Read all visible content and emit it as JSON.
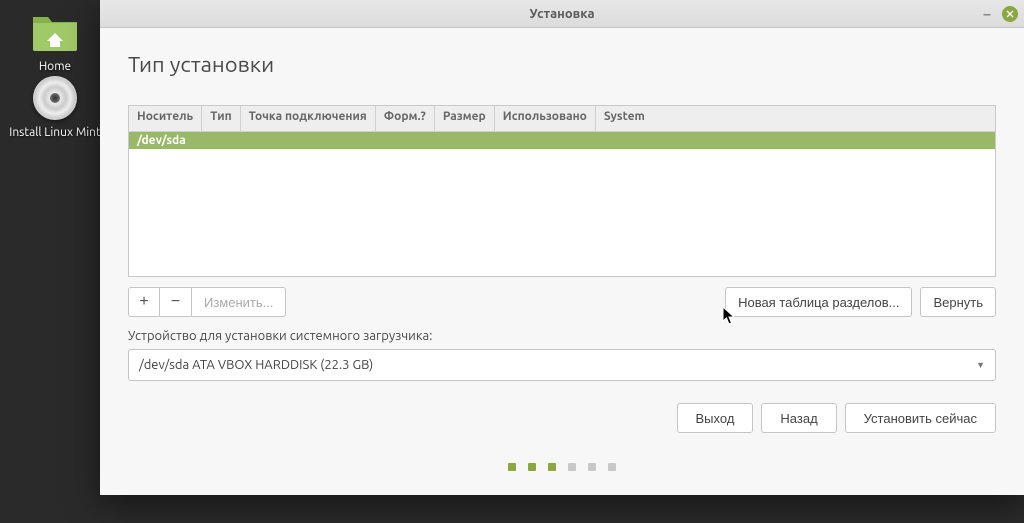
{
  "desktop": {
    "home_label": "Home",
    "installer_label": "Install Linux Mint"
  },
  "window": {
    "title": "Установка"
  },
  "page": {
    "title": "Тип установки"
  },
  "table": {
    "columns": [
      "Носитель",
      "Тип",
      "Точка подключения",
      "Форм.?",
      "Размер",
      "Использовано",
      "System"
    ],
    "rows": [
      {
        "device": "/dev/sda"
      }
    ]
  },
  "toolbar": {
    "add": "+",
    "remove": "−",
    "change": "Изменить...",
    "new_table": "Новая таблица разделов...",
    "revert": "Вернуть"
  },
  "bootloader": {
    "label": "Устройство для установки системного загрузчика:",
    "value": "/dev/sda  ATA VBOX HARDDISK (22.3 GB)"
  },
  "nav": {
    "quit": "Выход",
    "back": "Назад",
    "install": "Установить сейчас"
  },
  "progress": {
    "total": 6,
    "active_indices": [
      0,
      1,
      2
    ]
  }
}
